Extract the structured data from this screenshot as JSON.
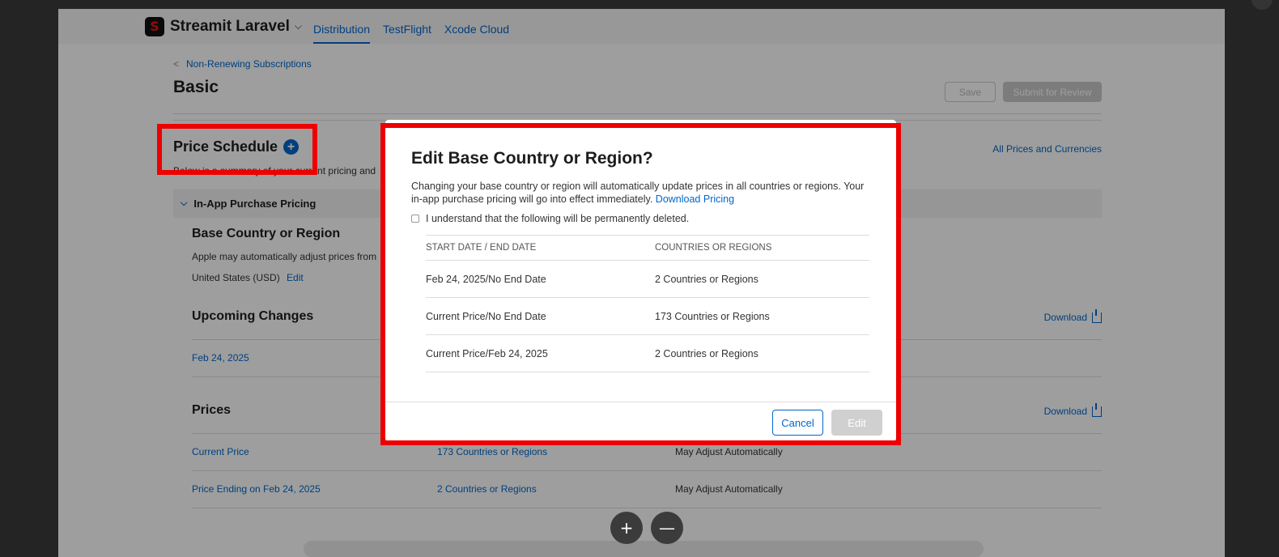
{
  "nav": {
    "logo_letter": "S",
    "app_name": "Streamit Laravel",
    "tabs": [
      {
        "label": "Distribution"
      },
      {
        "label": "TestFlight"
      },
      {
        "label": "Xcode Cloud"
      }
    ]
  },
  "page": {
    "breadcrumb": "Non-Renewing Subscriptions",
    "title": "Basic",
    "save_label": "Save",
    "submit_label": "Submit for Review",
    "price_schedule_title": "Price Schedule",
    "price_schedule_sub": "Below is a summary of your current pricing and",
    "all_prices_link": "All Prices and Currencies",
    "iap_pricing": "In-App Purchase Pricing",
    "base_title": "Base Country or Region",
    "base_desc": "Apple may automatically adjust prices from",
    "base_value": "United States (USD)",
    "base_edit": "Edit",
    "upcoming_title": "Upcoming Changes",
    "upcoming_download": "Download",
    "upcoming_date": "Feb 24, 2025",
    "prices_title": "Prices",
    "prices_download": "Download",
    "price_rows": [
      {
        "name": "Current Price",
        "countries": "173 Countries or Regions",
        "adjust": "May Adjust Automatically"
      },
      {
        "name": "Price Ending on Feb 24, 2025",
        "countries": "2 Countries or Regions",
        "adjust": "May Adjust Automatically"
      }
    ]
  },
  "modal": {
    "title": "Edit Base Country or Region?",
    "text": "Changing your base country or region will automatically update prices in all countries or regions. Your in-app purchase pricing will go into effect immediately.",
    "download_link": "Download Pricing",
    "checkbox_label": "I understand that the following will be permanently deleted.",
    "columns": [
      "START DATE / END DATE",
      "COUNTRIES OR REGIONS"
    ],
    "rows": [
      [
        "Feb 24, 2025/No End Date",
        "2 Countries or Regions"
      ],
      [
        "Current Price/No End Date",
        "173 Countries or Regions"
      ],
      [
        "Current Price/Feb 24, 2025",
        "2 Countries or Regions"
      ]
    ],
    "cancel_label": "Cancel",
    "edit_label": "Edit"
  },
  "zoom": {
    "in": "+",
    "out": "—"
  },
  "colors": {
    "accent": "#0066cc",
    "highlight": "#ee0000"
  }
}
